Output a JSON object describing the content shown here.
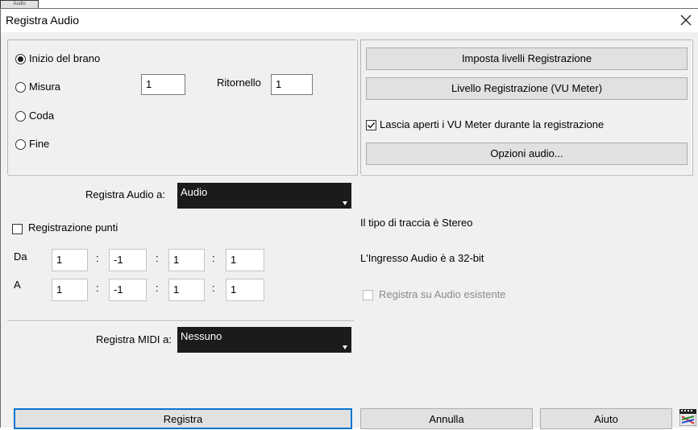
{
  "top_strip": {
    "button_label": "Audio"
  },
  "dialog": {
    "title": "Registra Audio"
  },
  "start_options": [
    {
      "label": "Inizio del brano",
      "selected": true
    },
    {
      "label": "Misura",
      "selected": false
    },
    {
      "label": "Coda",
      "selected": false
    },
    {
      "label": "Fine",
      "selected": false
    }
  ],
  "measure_value": "1",
  "chorus": {
    "label": "Ritornello",
    "value": "1"
  },
  "buttons": {
    "set_levels": "Imposta livelli Registrazione",
    "vu_meter": "Livello Registrazione (VU Meter)",
    "audio_options": "Opzioni audio...",
    "record": "Registra",
    "cancel": "Annulla",
    "help": "Aiuto"
  },
  "leave_vu_open": {
    "label": "Lascia aperti i VU Meter durante la registrazione",
    "checked": true
  },
  "record_audio_to": {
    "label": "Registra Audio a:",
    "value": "Audio"
  },
  "punch_in": {
    "label": "Registrazione punti",
    "checked": false
  },
  "from_row": {
    "label": "Da",
    "values": [
      "1",
      "-1",
      "1",
      "1"
    ]
  },
  "to_row": {
    "label": "A",
    "values": [
      "1",
      "-1",
      "1",
      "1"
    ]
  },
  "separator": ":",
  "info": {
    "track_type": "Il tipo di traccia è Stereo",
    "audio_input": "L'Ingresso Audio è a 32-bit"
  },
  "record_on_existing": {
    "label": "Registra su Audio esistente",
    "checked": false,
    "enabled": false
  },
  "record_midi_to": {
    "label": "Registra MIDI a:",
    "value": "Nessuno"
  },
  "colors": {
    "default_button_border": "#0a74d1",
    "dropdown_bg": "#1b1b1b",
    "dialog_bg": "#f0f0f0"
  }
}
